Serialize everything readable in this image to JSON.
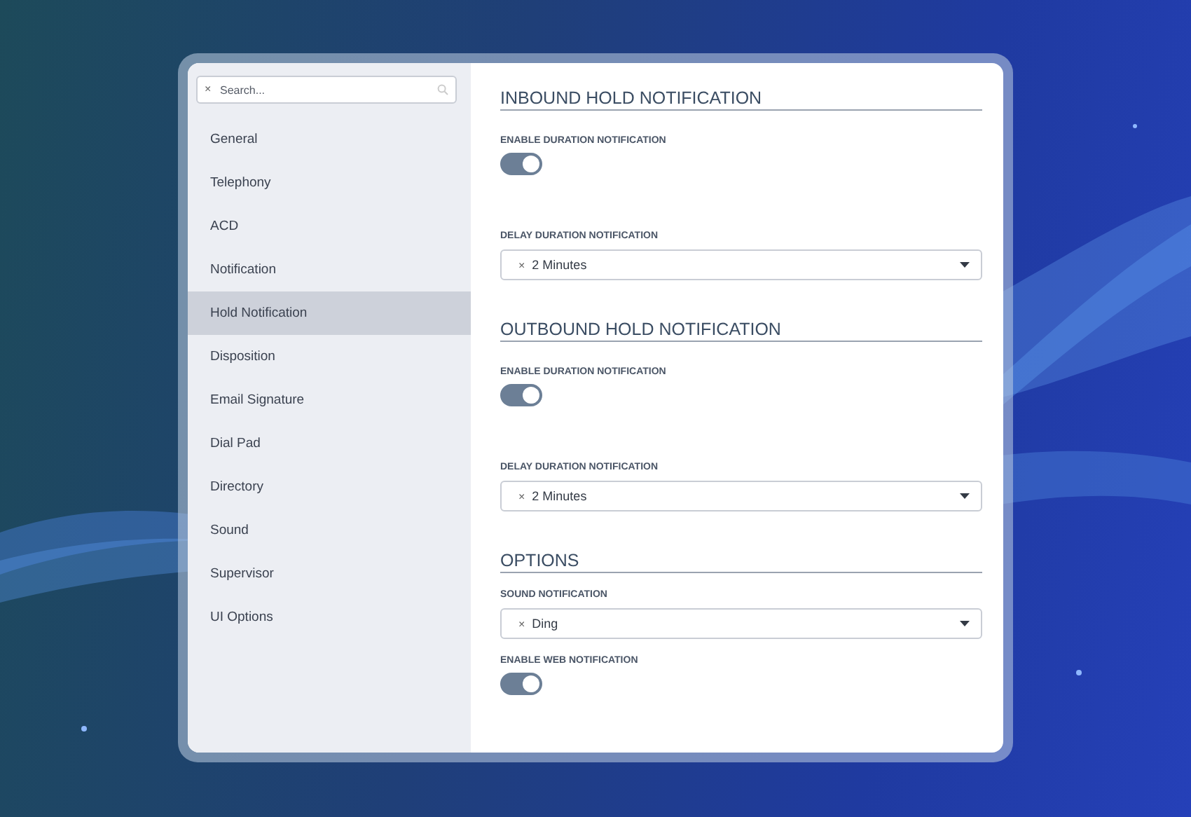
{
  "search": {
    "placeholder": "Search...",
    "clear": "×"
  },
  "sidebar": {
    "items": [
      {
        "label": "General",
        "selected": false
      },
      {
        "label": "Telephony",
        "selected": false
      },
      {
        "label": "ACD",
        "selected": false
      },
      {
        "label": "Notification",
        "selected": false
      },
      {
        "label": "Hold Notification",
        "selected": true
      },
      {
        "label": "Disposition",
        "selected": false
      },
      {
        "label": "Email Signature",
        "selected": false
      },
      {
        "label": "Dial Pad",
        "selected": false
      },
      {
        "label": "Directory",
        "selected": false
      },
      {
        "label": "Sound",
        "selected": false
      },
      {
        "label": "Supervisor",
        "selected": false
      },
      {
        "label": "UI Options",
        "selected": false
      }
    ]
  },
  "sections": [
    {
      "title": "INBOUND HOLD NOTIFICATION",
      "fields": [
        {
          "kind": "toggle",
          "label": "ENABLE DURATION NOTIFICATION",
          "on": true
        },
        {
          "kind": "select",
          "label": "DELAY DURATION NOTIFICATION",
          "clear": "×",
          "value": "2 Minutes"
        }
      ]
    },
    {
      "title": "OUTBOUND HOLD NOTIFICATION",
      "fields": [
        {
          "kind": "toggle",
          "label": "ENABLE DURATION NOTIFICATION",
          "on": true
        },
        {
          "kind": "select",
          "label": "DELAY DURATION NOTIFICATION",
          "clear": "×",
          "value": "2 Minutes"
        }
      ]
    },
    {
      "title": "OPTIONS",
      "fields": [
        {
          "kind": "select",
          "label": "SOUND NOTIFICATION",
          "clear": "×",
          "value": "Ding"
        },
        {
          "kind": "toggle",
          "label": "ENABLE WEB NOTIFICATION",
          "on": true
        }
      ]
    }
  ]
}
